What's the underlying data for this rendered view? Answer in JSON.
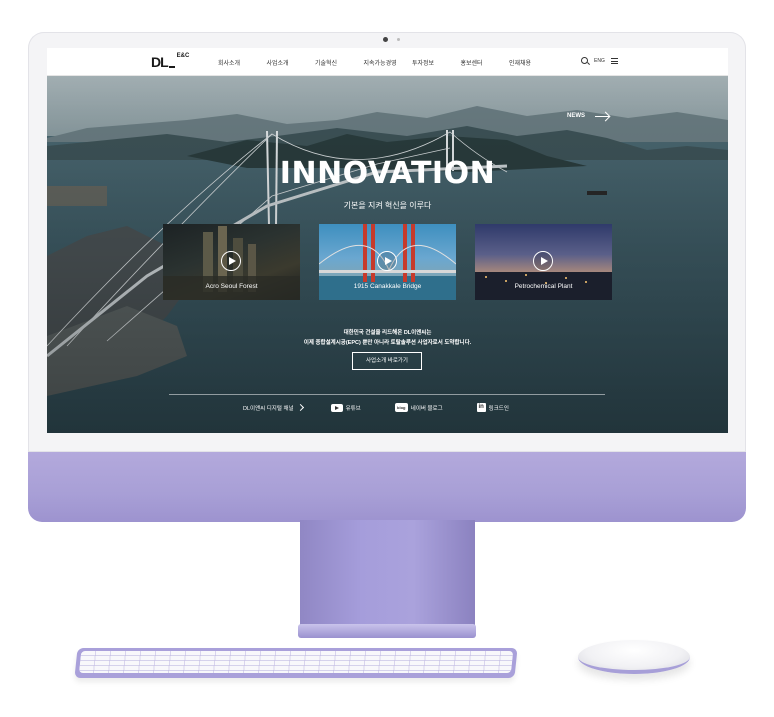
{
  "nav": {
    "logo_main": "DL",
    "logo_sub": "E&C",
    "menu": [
      "회사소개",
      "사업소개",
      "기술혁신",
      "지속가능경영",
      "투자정보",
      "홍보센터",
      "인재채용"
    ],
    "lang": "ENG"
  },
  "hero": {
    "news_label": "NEWS",
    "title": "INNOVATION",
    "subtitle": "기본을 지켜 혁신을 이루다",
    "cards": [
      {
        "caption": "Acro Seoul Forest"
      },
      {
        "caption": "1915 Canakkale Bridge"
      },
      {
        "caption": "Petrochemical Plant"
      }
    ],
    "desc_line1": "대한민국 건설을 리드해온 DL이앤씨는",
    "desc_line2": "이제 종합설계시공(EPC) 뿐만 아니라 토탈솔루션 사업자로서 도약합니다.",
    "cta": "사업소개 바로가기"
  },
  "social": {
    "digital_channel": "DL이앤씨 디지털 채널",
    "youtube": "유튜브",
    "blog_badge": "blog",
    "blog": "네이버 블로그",
    "linkedin_badge": "in",
    "linkedin": "링크드인"
  }
}
